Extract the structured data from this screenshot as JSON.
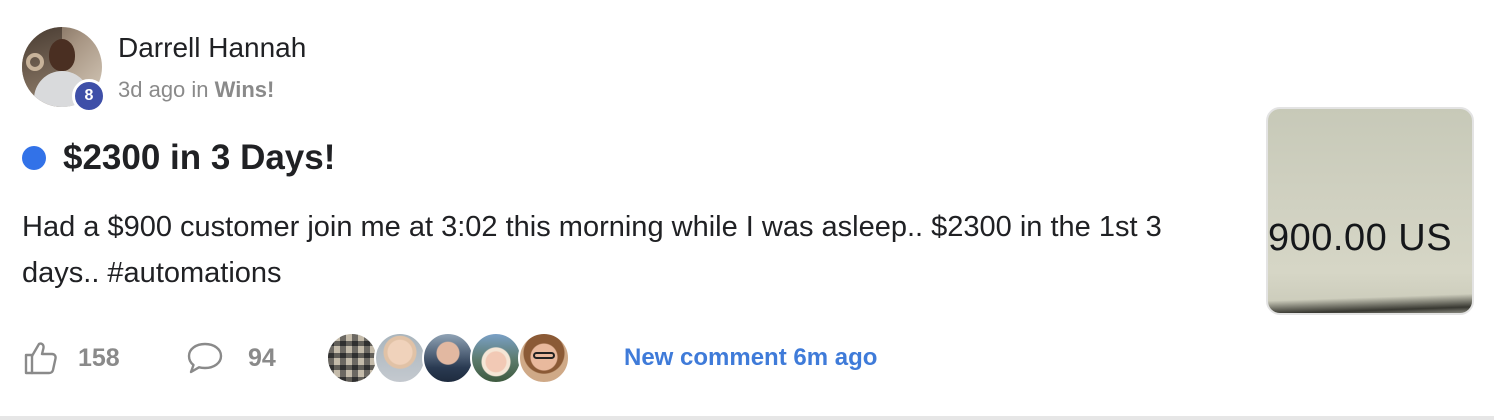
{
  "post": {
    "author": {
      "name": "Darrell Hannah",
      "level": "8"
    },
    "meta": {
      "time": "3d ago",
      "in_word": "in",
      "category": "Wins!"
    },
    "title": "$2300 in 3 Days!",
    "unread_color": "#3272e8",
    "body": "Had a $900 customer join me at 3:02 this morning while I was asleep.. $2300 in the 1st 3 days.. #automations",
    "thumbnail": {
      "text": "900.00 US"
    }
  },
  "footer": {
    "likes": "158",
    "comments": "94",
    "commenters": [
      "commenter-1",
      "commenter-2",
      "commenter-3",
      "commenter-4",
      "commenter-5"
    ],
    "new_comment": "New comment 6m ago",
    "link_color": "#3f7bd9"
  },
  "icons": {
    "like": "thumbs-up-icon",
    "comment": "speech-bubble-icon"
  }
}
